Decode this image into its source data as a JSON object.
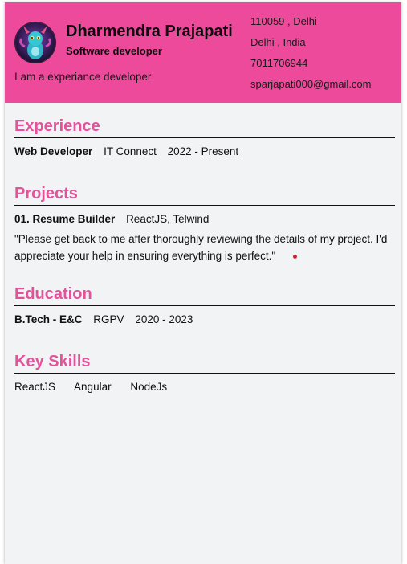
{
  "header": {
    "name": "Dharmendra Prajapati",
    "role": "Software developer",
    "tagline": "I am a experiance developer",
    "contact": {
      "pincode_city": "110059 , Delhi",
      "city_country": "Delhi , India",
      "phone": "7011706944",
      "email": "sparjapati000@gmail.com"
    }
  },
  "experience": {
    "title": "Experience",
    "items": [
      {
        "position": "Web Developer",
        "company": "IT Connect",
        "period": "2022 - Present"
      }
    ]
  },
  "projects": {
    "title": "Projects",
    "items": [
      {
        "name": "01. Resume Builder",
        "tech": "ReactJS, Telwind",
        "description": "\"Please get back to me after thoroughly reviewing the details of my project. I'd appreciate your help in ensuring everything is perfect.\""
      }
    ]
  },
  "education": {
    "title": "Education",
    "items": [
      {
        "degree": "B.Tech - E&C",
        "institute": "RGPV",
        "period": "2020 - 2023"
      }
    ]
  },
  "skills": {
    "title": "Key Skills",
    "items": [
      "ReactJS",
      "Angular",
      "NodeJs"
    ]
  },
  "colors": {
    "header_bg": "#ee4a9b",
    "section_title": "#e4529c",
    "page_bg": "#f2f3f5"
  }
}
